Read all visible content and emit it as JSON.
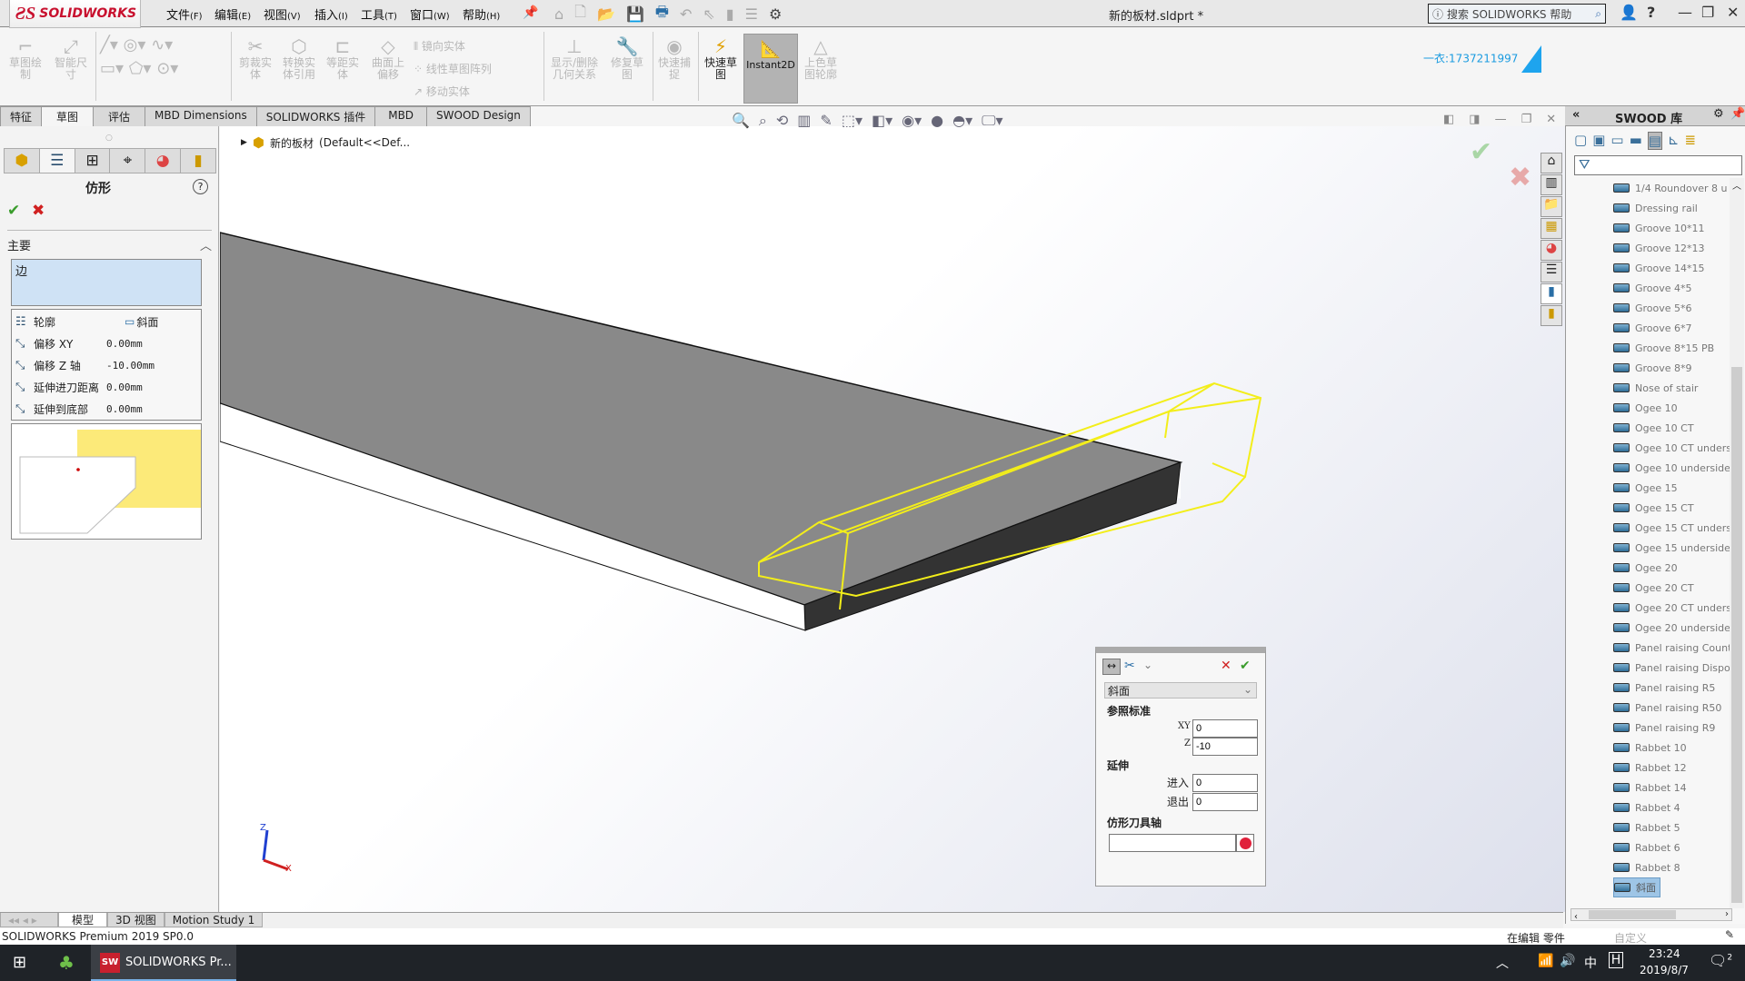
{
  "app": {
    "logo_ds": "ƧS",
    "logo_text": "SOLIDWORKS",
    "doc_title": "新的板材.sldprt *"
  },
  "menu": [
    {
      "label": "文件",
      "key": "(F)"
    },
    {
      "label": "编辑",
      "key": "(E)"
    },
    {
      "label": "视图",
      "key": "(V)"
    },
    {
      "label": "插入",
      "key": "(I)"
    },
    {
      "label": "工具",
      "key": "(T)"
    },
    {
      "label": "窗口",
      "key": "(W)"
    },
    {
      "label": "帮助",
      "key": "(H)"
    }
  ],
  "help_search": {
    "placeholder": "搜索 SOLIDWORKS 帮助"
  },
  "watermark": {
    "text": "一衣:1737211997"
  },
  "commands": {
    "sketch": "草图绘制",
    "smart_dim": "智能尺寸",
    "trim": "剪裁实体",
    "convert": "转换实体引用",
    "offset": "等距实体",
    "offset_surface": "曲面上偏移",
    "mirror": "镜向实体",
    "linear_pattern": "线性草图阵列",
    "move": "移动实体",
    "relations": "显示/删除几何关系",
    "repair": "修复草图",
    "snap": "快速捕捉",
    "rapid_sketch": "快速草图",
    "instant2d": "Instant2D",
    "shaded": "上色草图轮廓"
  },
  "tabs": [
    "特征",
    "草图",
    "评估",
    "MBD Dimensions",
    "SOLIDWORKS 插件",
    "MBD",
    "SWOOD Design"
  ],
  "active_tab": "草图",
  "tree": {
    "root": "新的板材",
    "config": "(Default<<Def..."
  },
  "property_manager": {
    "title": "仿形",
    "group": "主要",
    "selection": "边",
    "rows": [
      {
        "label": "轮廓",
        "value": "斜面"
      },
      {
        "label": "偏移 XY",
        "value": "0.00mm"
      },
      {
        "label": "偏移 Z 轴",
        "value": "-10.00mm"
      },
      {
        "label": "延伸进刀距离",
        "value": "0.00mm"
      },
      {
        "label": "延伸到底部",
        "value": "0.00mm"
      }
    ]
  },
  "float_dialog": {
    "profile": "斜面",
    "ref_label": "参照标准",
    "xy_label": "XY",
    "xy_value": "0",
    "z_label": "Z",
    "z_value": "-10",
    "ext_label": "延伸",
    "in_label": "进入",
    "in_value": "0",
    "out_label": "退出",
    "out_value": "0",
    "axis_label": "仿形刀具轴",
    "axis_value": ""
  },
  "swood": {
    "title": "SWOOD 库",
    "items": [
      "1/4 Roundover 8 u",
      "Dressing rail",
      "Groove 10*11",
      "Groove 12*13",
      "Groove 14*15",
      "Groove 4*5",
      "Groove 5*6",
      "Groove 6*7",
      "Groove 8*15 PB",
      "Groove 8*9",
      "Nose of stair",
      "Ogee 10",
      "Ogee 10 CT",
      "Ogee 10 CT unders",
      "Ogee 10 underside",
      "Ogee 15",
      "Ogee 15 CT",
      "Ogee 15 CT unders",
      "Ogee 15 underside",
      "Ogee 20",
      "Ogee 20 CT",
      "Ogee 20 CT unders",
      "Ogee 20 underside",
      "Panel raising Count",
      "Panel raising Dispo",
      "Panel raising R5",
      "Panel raising R50",
      "Panel raising R9",
      "Rabbet 10",
      "Rabbet 12",
      "Rabbet 14",
      "Rabbet 4",
      "Rabbet 5",
      "Rabbet 6",
      "Rabbet 8"
    ],
    "selected": "斜面"
  },
  "bottom_tabs": [
    "模型",
    "3D 视图",
    "Motion Study 1"
  ],
  "status": {
    "product": "SOLIDWORKS Premium 2019 SP0.0",
    "mode": "在编辑 零件",
    "custom": "自定义"
  },
  "taskbar": {
    "app": "SOLIDWORKS Pr...",
    "ime": "中",
    "time": "23:24",
    "date": "2019/8/7",
    "notif": "2"
  },
  "colors": {
    "accent": "#c8102e",
    "selection_yellow": "#f3ee1a",
    "ok": "#3a9c2c",
    "cancel": "#d02020"
  }
}
